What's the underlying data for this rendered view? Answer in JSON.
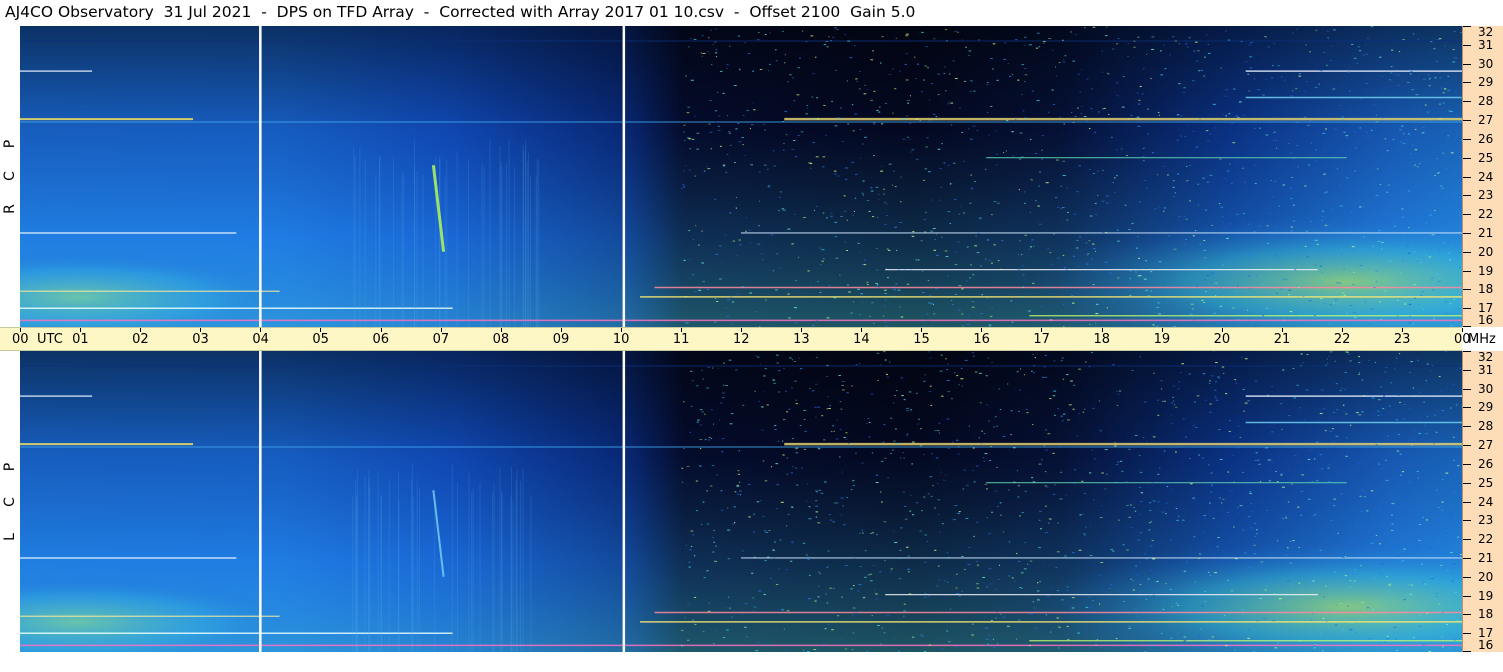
{
  "title": "AJ4CO Observatory  31 Jul 2021  -  DPS on TFD Array  -  Corrected with Array 2017 01 10.csv  -  Offset 2100  Gain 5.0",
  "panels": [
    {
      "id": "rcp",
      "letters": [
        "P",
        "C",
        "R"
      ]
    },
    {
      "id": "lcp",
      "letters": [
        "P",
        "C",
        "L"
      ]
    }
  ],
  "time_axis": {
    "labels": [
      "00",
      "01",
      "02",
      "03",
      "04",
      "05",
      "06",
      "07",
      "08",
      "09",
      "10",
      "11",
      "12",
      "13",
      "14",
      "15",
      "16",
      "17",
      "18",
      "19",
      "20",
      "21",
      "22",
      "23",
      "00"
    ],
    "utc_label": "UTC",
    "unit_label": "MHz"
  },
  "freq_axis": {
    "labels": [
      "32",
      "31",
      "30",
      "29",
      "28",
      "27",
      "26",
      "25",
      "24",
      "23",
      "22",
      "21",
      "20",
      "19",
      "18",
      "17",
      "16"
    ]
  },
  "colors": {
    "background_dark": "#030b22",
    "axis_yellow": "#fdf7c6",
    "axis_peach": "#fddcb8",
    "marker_white": "#ffffff"
  },
  "chart_data": {
    "type": "heatmap",
    "title": "AJ4CO Observatory  31 Jul 2021  -  DPS on TFD Array  -  Corrected with Array 2017 01 10.csv  -  Offset 2100  Gain 5.0",
    "xlabel": "UTC",
    "ylabel": "MHz",
    "x_range_hours": [
      0,
      24
    ],
    "y_range_mhz": [
      16,
      32
    ],
    "time_markers_hours": [
      4.0,
      10.05
    ],
    "series": [
      {
        "name": "RCP",
        "description_rows": "R C P"
      },
      {
        "name": "LCP",
        "description_rows": "L C P"
      }
    ]
  }
}
